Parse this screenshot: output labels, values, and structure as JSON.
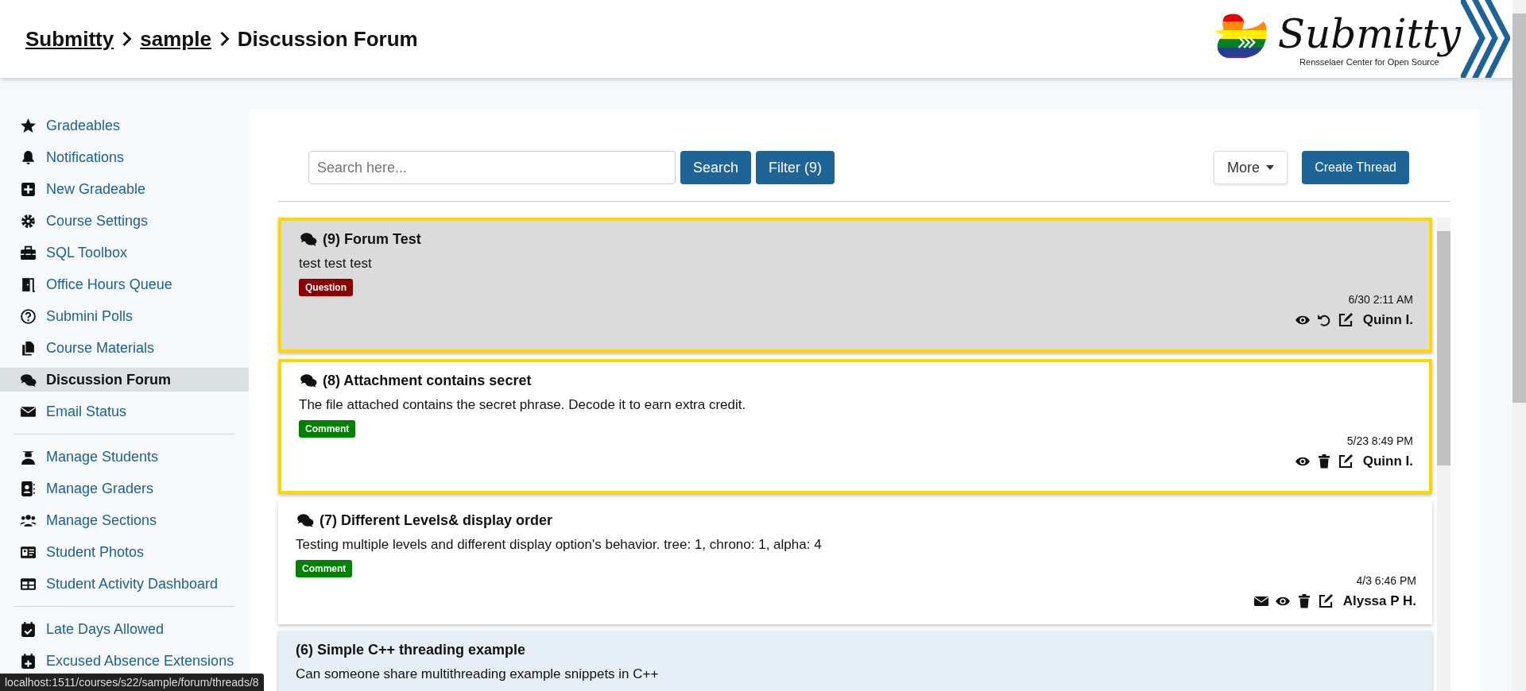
{
  "breadcrumb": [
    "Submitty",
    "sample",
    "Discussion Forum"
  ],
  "logo": {
    "wordmark": "Submitty",
    "tagline": "Rensselaer Center for Open Source"
  },
  "sidebar": {
    "groups": [
      [
        {
          "label": "Gradeables",
          "selected": false
        },
        {
          "label": "Notifications",
          "selected": false
        },
        {
          "label": "New Gradeable",
          "selected": false
        },
        {
          "label": "Course Settings",
          "selected": false
        },
        {
          "label": "SQL Toolbox",
          "selected": false
        },
        {
          "label": "Office Hours Queue",
          "selected": false
        },
        {
          "label": "Submini Polls",
          "selected": false
        },
        {
          "label": "Course Materials",
          "selected": false
        },
        {
          "label": "Discussion Forum",
          "selected": true
        },
        {
          "label": "Email Status",
          "selected": false
        }
      ],
      [
        {
          "label": "Manage Students",
          "selected": false
        },
        {
          "label": "Manage Graders",
          "selected": false
        },
        {
          "label": "Manage Sections",
          "selected": false
        },
        {
          "label": "Student Photos",
          "selected": false
        },
        {
          "label": "Student Activity Dashboard",
          "selected": false
        }
      ],
      [
        {
          "label": "Late Days Allowed",
          "selected": false
        },
        {
          "label": "Excused Absence Extensions",
          "selected": false
        }
      ]
    ]
  },
  "toolbar": {
    "search": {
      "placeholder": "Search here..."
    },
    "search_button": "Search",
    "filter_button": "Filter (9)",
    "more_button": "More",
    "create_button": "Create Thread"
  },
  "threads": [
    {
      "title": "(9) Forum Test",
      "chat_icon": true,
      "body": "test test test",
      "tag": {
        "label": "Question",
        "kind": "question"
      },
      "date": "6/30 2:11 AM",
      "author": "Quinn I.",
      "emailable": false,
      "deleted": true,
      "unread": false,
      "highlighted": true
    },
    {
      "title": "(8) Attachment contains secret",
      "chat_icon": true,
      "body": "The file attached contains the secret phrase. Decode it to earn extra credit.",
      "tag": {
        "label": "Comment",
        "kind": "comment"
      },
      "date": "5/23 8:49 PM",
      "author": "Quinn I.",
      "emailable": false,
      "deleted": false,
      "unread": false,
      "highlighted": true
    },
    {
      "title": "(7) Different Levels& display order",
      "chat_icon": true,
      "body": "Testing multiple levels and different display option's behavior. tree: 1, chrono: 1, alpha: 4",
      "tag": {
        "label": "Comment",
        "kind": "comment"
      },
      "date": "4/3 6:46 PM",
      "author": "Alyssa P H.",
      "emailable": true,
      "deleted": false,
      "unread": false,
      "highlighted": false
    },
    {
      "title": "(6) Simple C++ threading example",
      "chat_icon": false,
      "body": "Can someone share multithreading example snippets in C++",
      "unread": true,
      "highlighted": false
    }
  ],
  "status_bar": "localhost:1511/courses/s22/sample/forum/threads/8"
}
